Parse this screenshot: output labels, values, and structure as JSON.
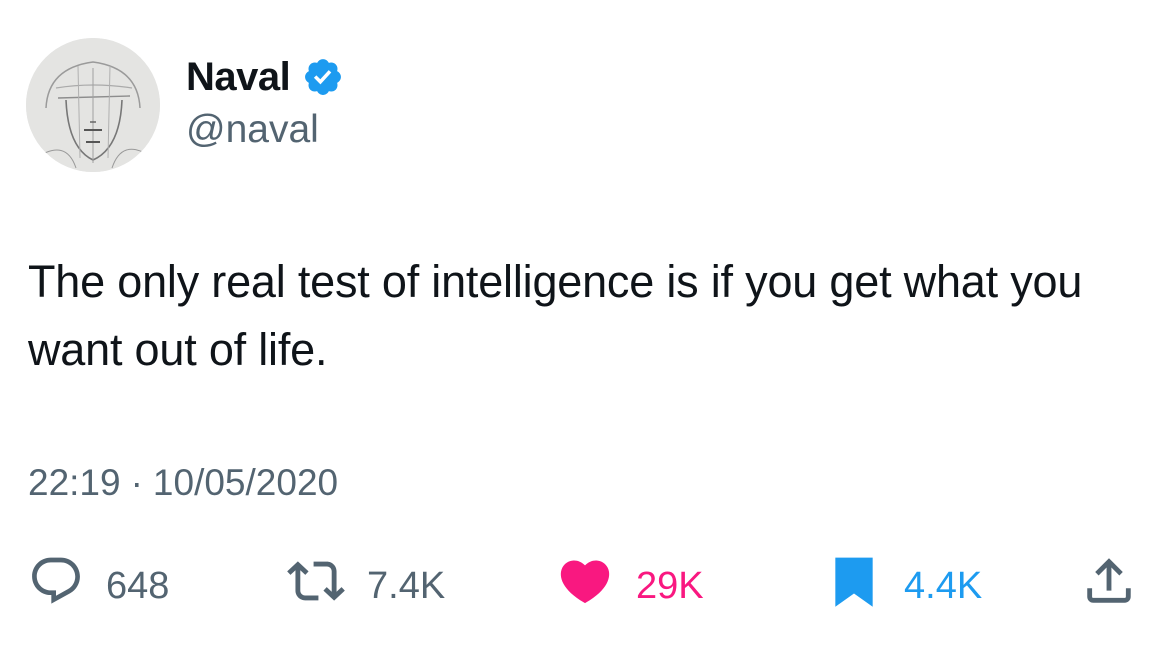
{
  "author": {
    "display_name": "Naval",
    "handle": "@naval",
    "verified": true,
    "avatar_icon": "avatar-sketch-face"
  },
  "tweet": {
    "text": "The only real test of intelligence is if you get what you want out of life.",
    "time": "22:19",
    "separator": "·",
    "date": "10/05/2020"
  },
  "actions": {
    "replies": "648",
    "retweets": "7.4K",
    "likes": "29K",
    "bookmarks": "4.4K"
  },
  "colors": {
    "text": "#0f1419",
    "secondary": "#536471",
    "verified_blue": "#1d9bf0",
    "like_pink": "#f91880",
    "bookmark_blue": "#1d9bf0"
  }
}
